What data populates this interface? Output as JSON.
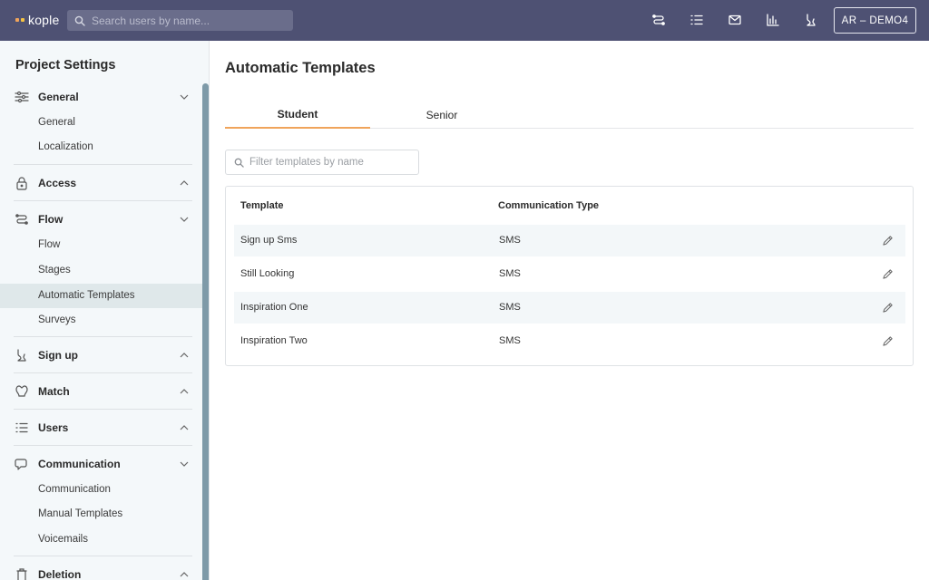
{
  "topbar": {
    "logo_text": "kople",
    "logo_colors": [
      "#f0a45b",
      "#f5c242"
    ],
    "search_placeholder": "Search users by name...",
    "icons": [
      "flow-icon",
      "list-icon",
      "mail-icon",
      "chart-icon",
      "signup-icon"
    ],
    "account_label": "AR – DEMO4"
  },
  "sidebar": {
    "title": "Project Settings",
    "sections": [
      {
        "label": "General",
        "icon": "sliders-icon",
        "expanded": true,
        "items": [
          "General",
          "Localization"
        ]
      },
      {
        "label": "Access",
        "icon": "lock-icon",
        "expanded": false,
        "items": []
      },
      {
        "label": "Flow",
        "icon": "flow-icon",
        "expanded": true,
        "items": [
          "Flow",
          "Stages",
          "Automatic Templates",
          "Surveys"
        ]
      },
      {
        "label": "Sign up",
        "icon": "signup-icon",
        "expanded": false,
        "items": []
      },
      {
        "label": "Match",
        "icon": "match-icon",
        "expanded": false,
        "items": []
      },
      {
        "label": "Users",
        "icon": "list-icon",
        "expanded": false,
        "items": []
      },
      {
        "label": "Communication",
        "icon": "chat-icon",
        "expanded": true,
        "items": [
          "Communication",
          "Manual Templates",
          "Voicemails"
        ]
      },
      {
        "label": "Deletion",
        "icon": "trash-icon",
        "expanded": false,
        "items": []
      }
    ],
    "active_item": "Automatic Templates"
  },
  "main": {
    "title": "Automatic Templates",
    "tabs": [
      {
        "label": "Student",
        "active": true
      },
      {
        "label": "Senior",
        "active": false
      }
    ],
    "filter_placeholder": "Filter templates by name",
    "table": {
      "headers": [
        "Template",
        "Communication Type"
      ],
      "rows": [
        {
          "template": "Sign up Sms",
          "type": "SMS"
        },
        {
          "template": "Still Looking",
          "type": "SMS"
        },
        {
          "template": "Inspiration One",
          "type": "SMS"
        },
        {
          "template": "Inspiration Two",
          "type": "SMS"
        }
      ]
    }
  },
  "colors": {
    "topbar": "#4e5173",
    "accent": "#f0a45b",
    "sidebar_bg": "#f4f8fa",
    "active_item_bg": "#dfe8ea"
  }
}
